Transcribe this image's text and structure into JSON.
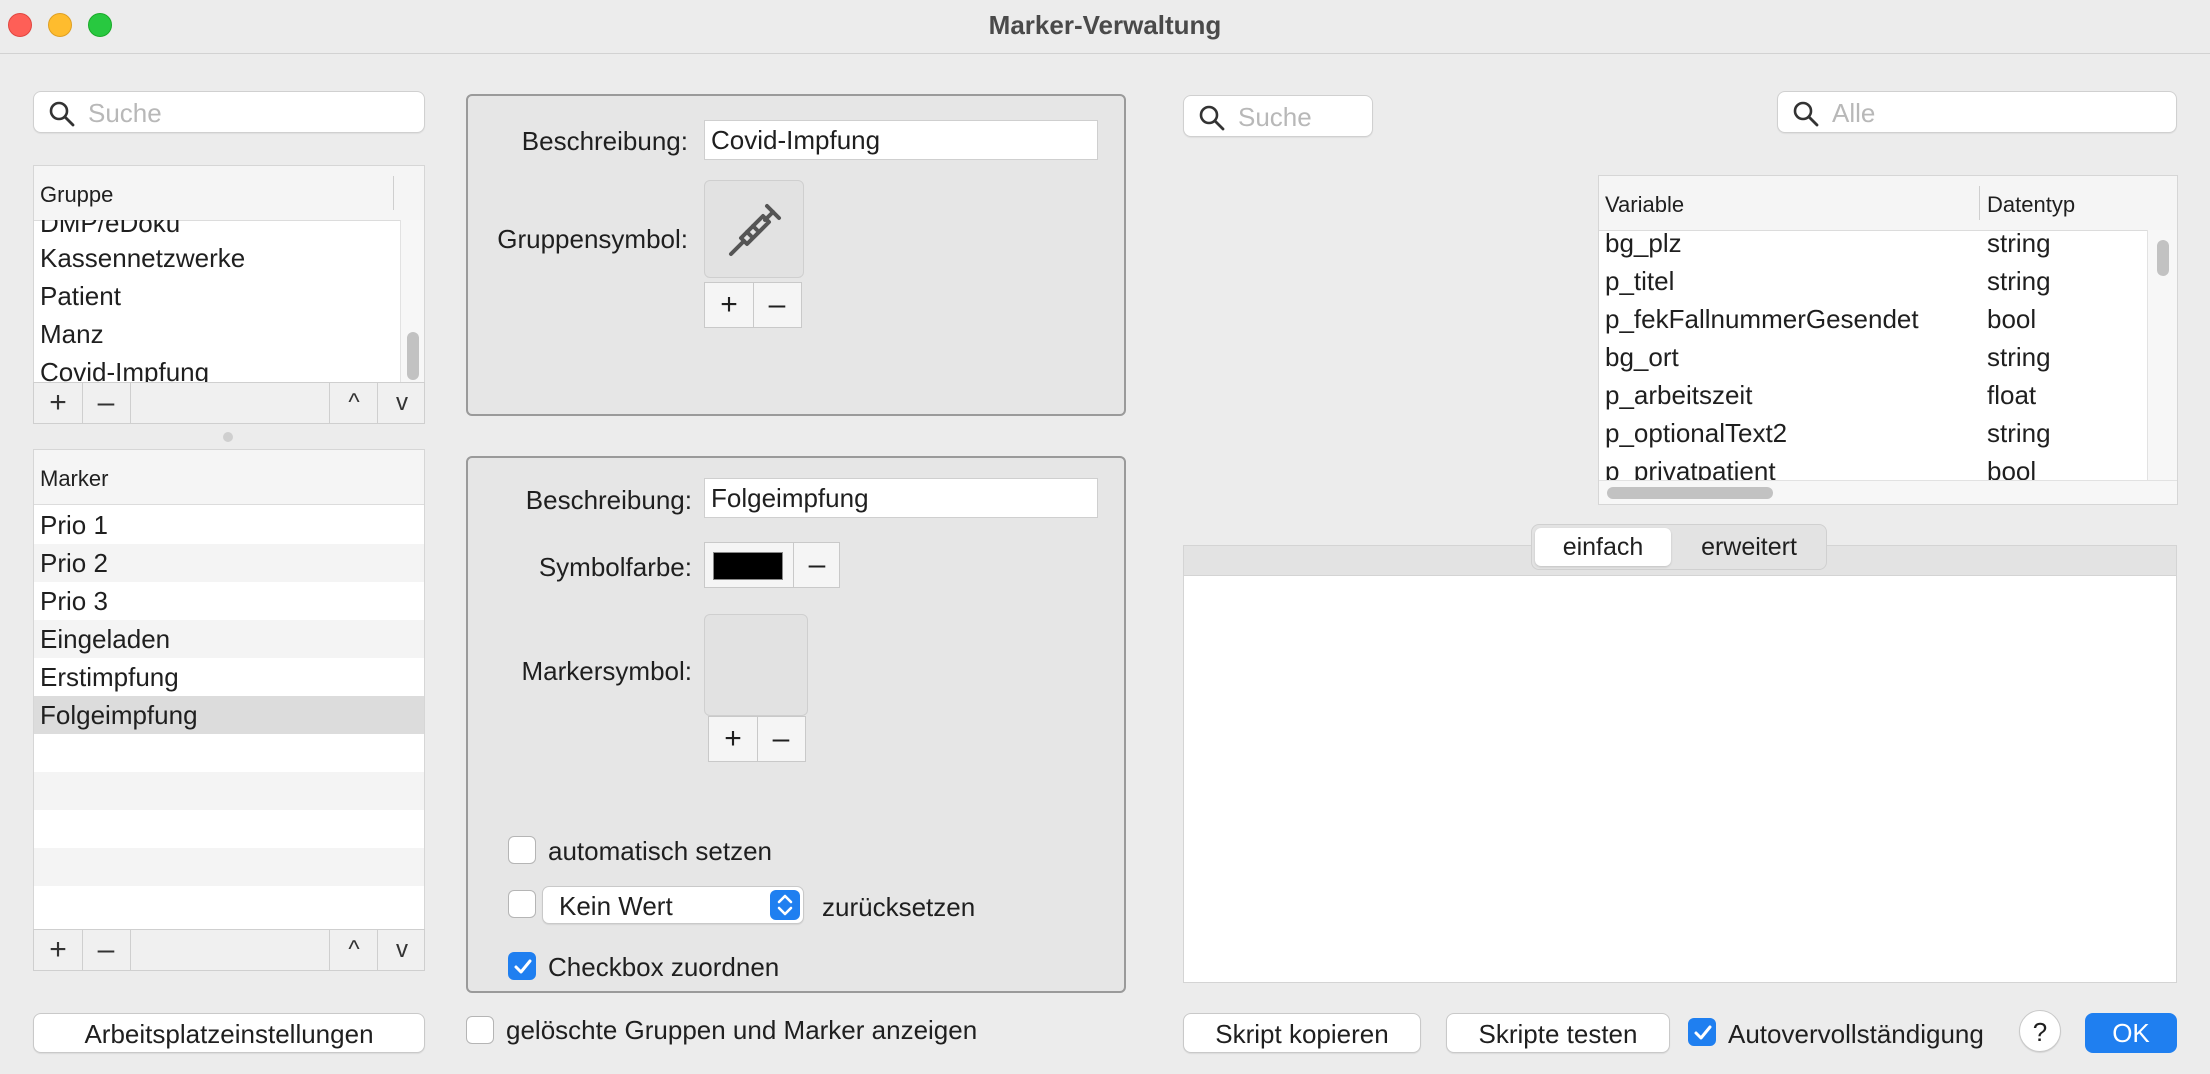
{
  "window": {
    "title": "Marker-Verwaltung"
  },
  "left": {
    "search_placeholder": "Suche",
    "group_header": "Gruppe",
    "groups": [
      "DMP/eDoku",
      "Kassennetzwerke",
      "Patient",
      "Manz",
      "Covid-Impfung"
    ],
    "marker_header": "Marker",
    "markers": [
      "Prio 1",
      "Prio 2",
      "Prio 3",
      "Eingeladen",
      "Erstimpfung",
      "Folgeimpfung"
    ],
    "selected_marker": "Folgeimpfung",
    "add": "+",
    "remove": "–",
    "up": "^",
    "down": "v",
    "workplace_button": "Arbeitsplatzeinstellungen"
  },
  "group_panel": {
    "desc_label": "Beschreibung:",
    "desc_value": "Covid-Impfung",
    "symbol_label": "Gruppensymbol:",
    "symbol_icon": "syringe-icon"
  },
  "marker_panel": {
    "desc_label": "Beschreibung:",
    "desc_value": "Folgeimpfung",
    "color_label": "Symbolfarbe:",
    "color_value": "#000000",
    "symbol_label": "Markersymbol:",
    "auto_label": "automatisch setzen",
    "auto_checked": false,
    "reset_select": "Kein Wert",
    "reset_checked": false,
    "reset_label": "zurücksetzen",
    "checkbox_assign_label": "Checkbox zuordnen",
    "checkbox_assign_checked": true
  },
  "show_deleted": {
    "label": "gelöschte Gruppen und Marker anzeigen",
    "checked": false
  },
  "right": {
    "search1_placeholder": "Suche",
    "search2_placeholder": "Alle",
    "var_header": "Variable",
    "type_header": "Datentyp",
    "variables": [
      {
        "name": "bg_plz",
        "type": "string"
      },
      {
        "name": "p_titel",
        "type": "string"
      },
      {
        "name": "p_fekFallnummerGesendet",
        "type": "bool"
      },
      {
        "name": "bg_ort",
        "type": "string"
      },
      {
        "name": "p_arbeitszeit",
        "type": "float"
      },
      {
        "name": "p_optionalText2",
        "type": "string"
      },
      {
        "name": "p_privatpatient",
        "type": "bool"
      }
    ],
    "tab_simple": "einfach",
    "tab_advanced": "erweitert",
    "active_tab": "einfach",
    "copy_script": "Skript kopieren",
    "test_scripts": "Skripte testen",
    "autocomplete_label": "Autovervollständigung",
    "autocomplete_checked": true,
    "help": "?",
    "ok": "OK"
  },
  "colors": {
    "accent": "#1f7ff0",
    "ok_button": "#1f7ff0"
  }
}
